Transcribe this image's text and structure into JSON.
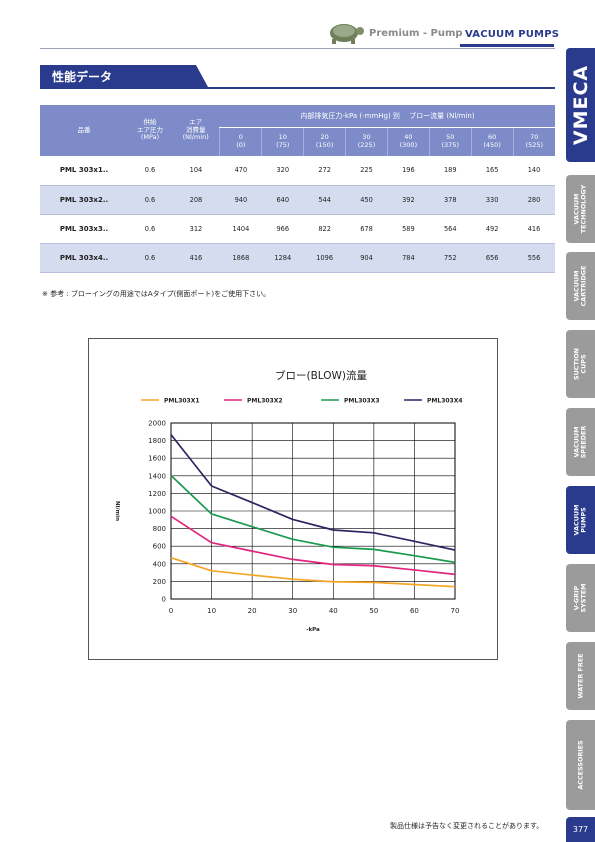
{
  "header": {
    "premium": "Premium - Pump",
    "category": "VACUUM PUMPS"
  },
  "section": {
    "title": "性能データ"
  },
  "table": {
    "col_model": "品番",
    "col_supply": [
      "供給",
      "エア圧力",
      "(MPa)"
    ],
    "col_air": [
      "エア",
      "消費量",
      "(Nl/min)"
    ],
    "group_header": "内部排気圧力-kPa (-mmHg) 別　 ブロー流量 (Nl/min)",
    "pressures": [
      {
        "kpa": "0",
        "mmhg": "(0)"
      },
      {
        "kpa": "10",
        "mmhg": "(75)"
      },
      {
        "kpa": "20",
        "mmhg": "(150)"
      },
      {
        "kpa": "30",
        "mmhg": "(225)"
      },
      {
        "kpa": "40",
        "mmhg": "(300)"
      },
      {
        "kpa": "50",
        "mmhg": "(375)"
      },
      {
        "kpa": "60",
        "mmhg": "(450)"
      },
      {
        "kpa": "70",
        "mmhg": "(525)"
      }
    ],
    "rows": [
      {
        "model": "PML 303x1..",
        "supply": "0.6",
        "air": "104",
        "flows": [
          "470",
          "320",
          "272",
          "225",
          "196",
          "189",
          "165",
          "140"
        ]
      },
      {
        "model": "PML 303x2..",
        "supply": "0.6",
        "air": "208",
        "flows": [
          "940",
          "640",
          "544",
          "450",
          "392",
          "378",
          "330",
          "280"
        ]
      },
      {
        "model": "PML 303x3..",
        "supply": "0.6",
        "air": "312",
        "flows": [
          "1404",
          "966",
          "822",
          "678",
          "589",
          "564",
          "492",
          "416"
        ]
      },
      {
        "model": "PML 303x4..",
        "supply": "0.6",
        "air": "416",
        "flows": [
          "1868",
          "1284",
          "1096",
          "904",
          "784",
          "752",
          "656",
          "556"
        ]
      }
    ]
  },
  "note": "※ 参考 :  ブローイングの用途ではAタイプ(側面ポート)をご使用下さい。",
  "chart_data": {
    "type": "line",
    "title": "ブロー(BLOW)流量",
    "xlabel": "-kPa",
    "ylabel": "Nl/min",
    "x": [
      0,
      10,
      20,
      30,
      40,
      50,
      60,
      70
    ],
    "xlim": [
      0,
      70
    ],
    "ylim": [
      0,
      2000
    ],
    "xticks": [
      "0",
      "10",
      "20",
      "30",
      "40",
      "50",
      "60",
      "70"
    ],
    "yticks": [
      "0",
      "200",
      "400",
      "600",
      "800",
      "1000",
      "1200",
      "1400",
      "1600",
      "1800",
      "2000"
    ],
    "grid": true,
    "legend_position": "top",
    "series": [
      {
        "name": "PML303X1",
        "color": "#f5a623",
        "values": [
          470,
          320,
          272,
          225,
          196,
          189,
          165,
          140
        ]
      },
      {
        "name": "PML303X2",
        "color": "#e0267d",
        "values": [
          940,
          640,
          544,
          450,
          392,
          378,
          330,
          280
        ]
      },
      {
        "name": "PML303X3",
        "color": "#1a9a4e",
        "values": [
          1404,
          966,
          822,
          678,
          589,
          564,
          492,
          416
        ]
      },
      {
        "name": "PML303X4",
        "color": "#2d2461",
        "values": [
          1868,
          1284,
          1096,
          904,
          784,
          752,
          656,
          556
        ]
      }
    ]
  },
  "side_tabs": {
    "brand": "VMECA",
    "items": [
      {
        "label": "VACUUM\nTECHNOLOGY",
        "active": false
      },
      {
        "label": "VACUUM\nCARTRIDGE",
        "active": false
      },
      {
        "label": "SUCTION\nCUPS",
        "active": false
      },
      {
        "label": "VACUUM\nSPEEDER",
        "active": false
      },
      {
        "label": "VACUUM\nPUMPS",
        "active": true
      },
      {
        "label": "V-GRIP\nSYSTEM",
        "active": false
      },
      {
        "label": "WATER FREE",
        "active": false
      },
      {
        "label": "ACCESSORIES",
        "active": false
      }
    ]
  },
  "footer": {
    "note": "製品仕様は予告なく変更されることがあります。",
    "page": "377"
  },
  "colors": {
    "brand_blue": "#2a3a8c",
    "table_header": "#7d8bc9",
    "row_alt": "#d6dcf0",
    "tab_gray": "#9b9b9b"
  }
}
